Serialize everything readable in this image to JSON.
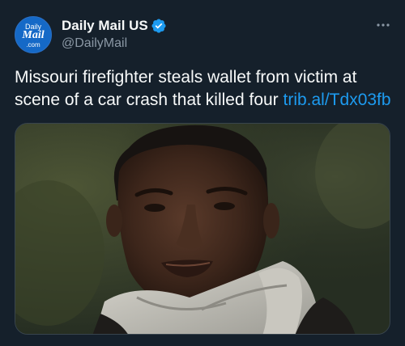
{
  "account": {
    "avatar_line1": "Daily",
    "avatar_line2": "Mail",
    "avatar_line3": ".com",
    "display_name": "Daily Mail US",
    "handle": "@DailyMail",
    "verified_icon": "verified-badge-icon"
  },
  "tweet": {
    "text": "Missouri firefighter steals wallet from victim at scene of a car crash that killed four ",
    "link": "trib.al/Tdx03fb"
  },
  "icons": {
    "more": "more-options-icon"
  },
  "colors": {
    "background": "#15202b",
    "text": "#f7f9f9",
    "secondary_text": "#8b98a5",
    "link": "#1d9bf0",
    "avatar": "#1569c7",
    "verified": "#1d9bf0"
  }
}
